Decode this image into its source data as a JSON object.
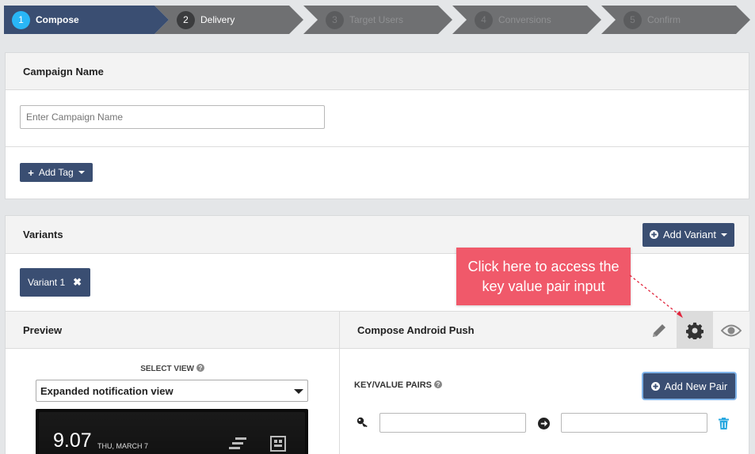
{
  "steps": [
    {
      "num": "1",
      "label": "Compose"
    },
    {
      "num": "2",
      "label": "Delivery"
    },
    {
      "num": "3",
      "label": "Target Users"
    },
    {
      "num": "4",
      "label": "Conversions"
    },
    {
      "num": "5",
      "label": "Confirm"
    }
  ],
  "campaign": {
    "title": "Campaign Name",
    "name_placeholder": "Enter Campaign Name",
    "add_tag_label": "Add Tag"
  },
  "variants": {
    "title": "Variants",
    "add_variant_label": "Add Variant",
    "chip_label": "Variant 1"
  },
  "tooltip": {
    "line1": "Click here to access the",
    "line2": "key value pair input"
  },
  "preview": {
    "title": "Preview",
    "select_view_label": "SELECT VIEW",
    "selected_view": "Expanded notification view",
    "phone_time": "9.07",
    "phone_date": "THU, MARCH 7"
  },
  "compose": {
    "title": "Compose Android Push",
    "kv_label": "KEY/VALUE PAIRS",
    "add_pair_label": "Add New Pair"
  },
  "colors": {
    "primary": "#3a4e72",
    "accent_blue": "#29b6f6",
    "tooltip": "#f0596a",
    "trash": "#29a8e0"
  }
}
